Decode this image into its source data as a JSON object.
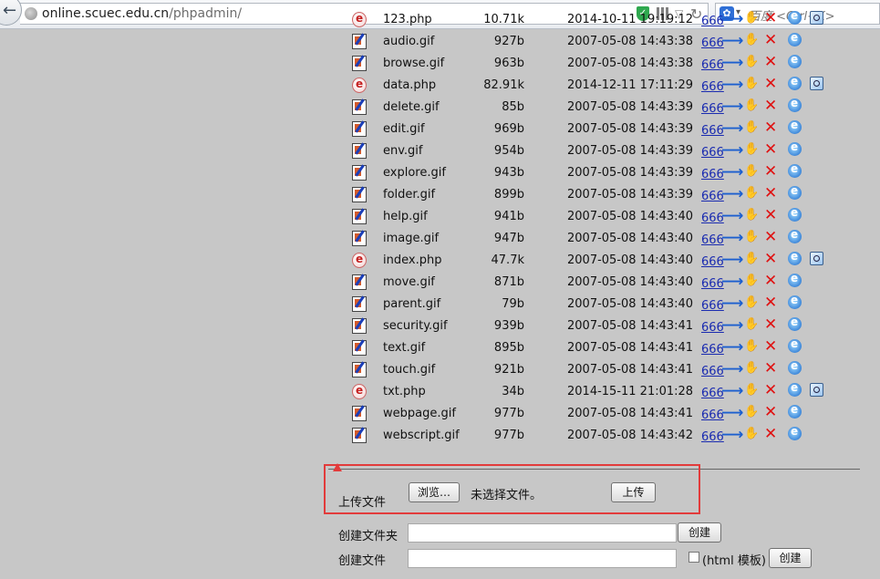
{
  "browser": {
    "url_host": "online.scuec.edu.cn",
    "url_path": "/phpadmin/",
    "search_placeholder": "百度 <Ctrl+K>"
  },
  "files": [
    {
      "name": "123.php",
      "size": "10.71k",
      "date": "2014-10-11 19:19:12",
      "type": "php",
      "perm": "666",
      "clipped": true
    },
    {
      "name": "audio.gif",
      "size": "927b",
      "date": "2007-05-08 14:43:38",
      "type": "gif",
      "perm": "666"
    },
    {
      "name": "browse.gif",
      "size": "963b",
      "date": "2007-05-08 14:43:38",
      "type": "gif",
      "perm": "666"
    },
    {
      "name": "data.php",
      "size": "82.91k",
      "date": "2014-12-11 17:11:29",
      "type": "php",
      "perm": "666"
    },
    {
      "name": "delete.gif",
      "size": "85b",
      "date": "2007-05-08 14:43:39",
      "type": "gif",
      "perm": "666"
    },
    {
      "name": "edit.gif",
      "size": "969b",
      "date": "2007-05-08 14:43:39",
      "type": "gif",
      "perm": "666"
    },
    {
      "name": "env.gif",
      "size": "954b",
      "date": "2007-05-08 14:43:39",
      "type": "gif",
      "perm": "666"
    },
    {
      "name": "explore.gif",
      "size": "943b",
      "date": "2007-05-08 14:43:39",
      "type": "gif",
      "perm": "666"
    },
    {
      "name": "folder.gif",
      "size": "899b",
      "date": "2007-05-08 14:43:39",
      "type": "gif",
      "perm": "666"
    },
    {
      "name": "help.gif",
      "size": "941b",
      "date": "2007-05-08 14:43:40",
      "type": "gif",
      "perm": "666"
    },
    {
      "name": "image.gif",
      "size": "947b",
      "date": "2007-05-08 14:43:40",
      "type": "gif",
      "perm": "666"
    },
    {
      "name": "index.php",
      "size": "47.7k",
      "date": "2007-05-08 14:43:40",
      "type": "php",
      "perm": "666"
    },
    {
      "name": "move.gif",
      "size": "871b",
      "date": "2007-05-08 14:43:40",
      "type": "gif",
      "perm": "666"
    },
    {
      "name": "parent.gif",
      "size": "79b",
      "date": "2007-05-08 14:43:40",
      "type": "gif",
      "perm": "666"
    },
    {
      "name": "security.gif",
      "size": "939b",
      "date": "2007-05-08 14:43:41",
      "type": "gif",
      "perm": "666"
    },
    {
      "name": "text.gif",
      "size": "895b",
      "date": "2007-05-08 14:43:41",
      "type": "gif",
      "perm": "666"
    },
    {
      "name": "touch.gif",
      "size": "921b",
      "date": "2007-05-08 14:43:41",
      "type": "gif",
      "perm": "666"
    },
    {
      "name": "txt.php",
      "size": "34b",
      "date": "2014-15-11 21:01:28",
      "type": "php",
      "perm": "666"
    },
    {
      "name": "webpage.gif",
      "size": "977b",
      "date": "2007-05-08 14:43:41",
      "type": "gif",
      "perm": "666"
    },
    {
      "name": "webscript.gif",
      "size": "977b",
      "date": "2007-05-08 14:43:42",
      "type": "gif",
      "perm": "666"
    }
  ],
  "upload": {
    "label": "上传文件",
    "browse_button": "浏览…",
    "no_file_text": "未选择文件。",
    "upload_button": "上传"
  },
  "create_folder": {
    "label": "创建文件夹",
    "value": "",
    "button": "创建"
  },
  "create_file": {
    "label": "创建文件",
    "value": "",
    "checkbox_label": "(html 模板)",
    "checkbox_checked": false,
    "button": "创建"
  }
}
